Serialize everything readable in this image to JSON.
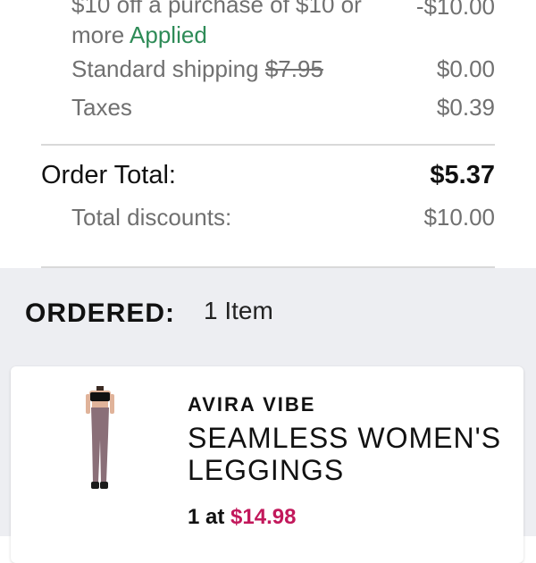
{
  "summary": {
    "discount": {
      "text": "$10 off a purchase of $10 or more",
      "status": "Applied",
      "amount": "-$10.00"
    },
    "shipping": {
      "label": "Standard shipping",
      "original": "$7.95",
      "amount": "$0.00"
    },
    "taxes": {
      "label": "Taxes",
      "amount": "$0.39"
    },
    "order_total": {
      "label": "Order Total:",
      "amount": "$5.37"
    },
    "total_discounts": {
      "label": "Total discounts:",
      "amount": "$10.00"
    }
  },
  "ordered": {
    "label": "ORDERED:",
    "count": "1 Item"
  },
  "item": {
    "brand": "AVIRA VIBE",
    "name": "SEAMLESS WOMEN'S LEGGINGS",
    "quantity_prefix": "1 at",
    "price": "$14.98"
  },
  "colors": {
    "applied": "#2e8b57",
    "price": "#c2185b",
    "band": "#edeef2"
  }
}
